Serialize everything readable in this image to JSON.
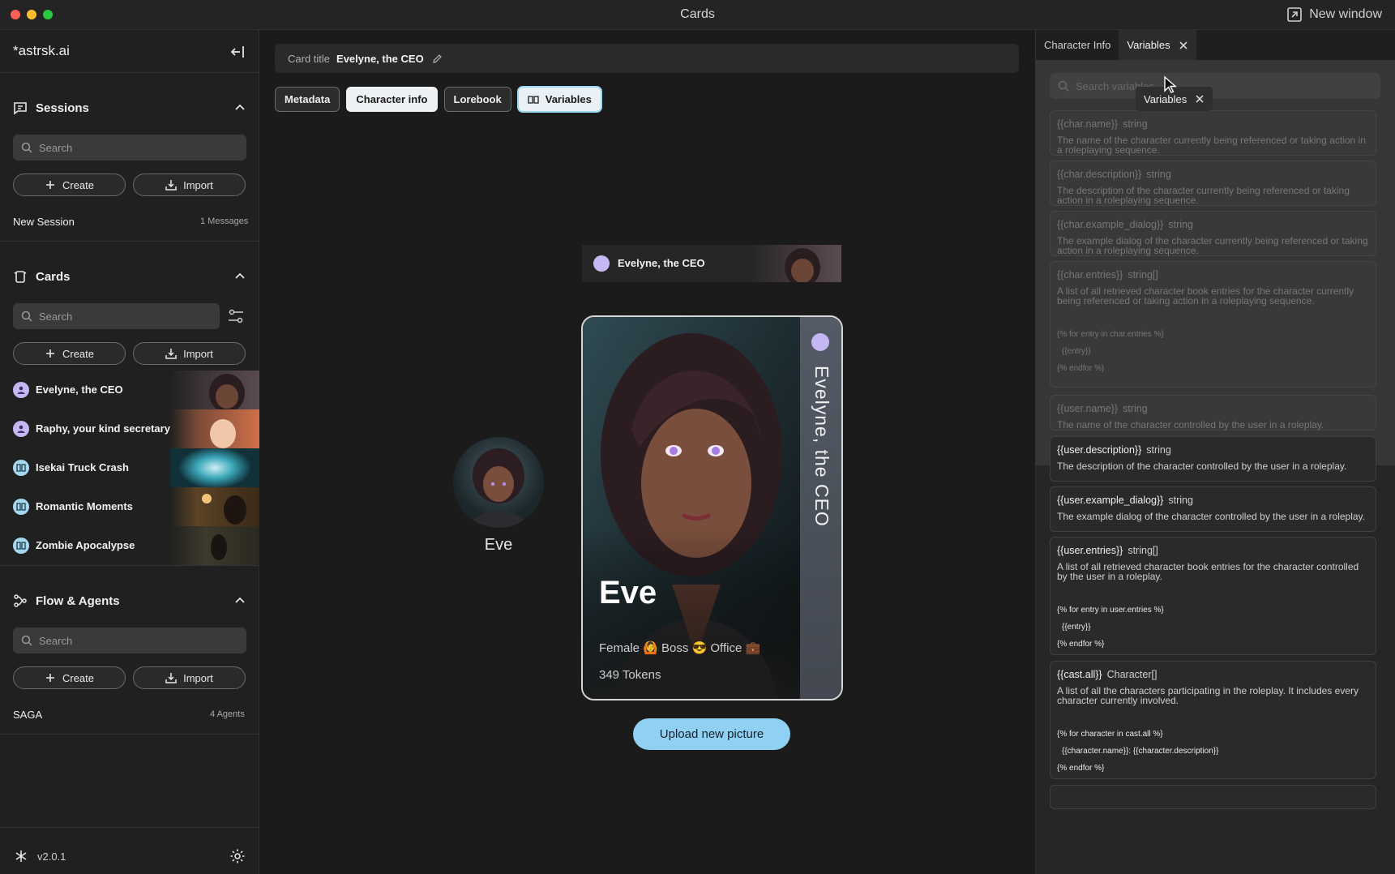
{
  "window": {
    "title": "Cards",
    "new_window": "New window"
  },
  "sidebar": {
    "brand": "*astrsk.ai",
    "sessions": {
      "title": "Sessions",
      "search_placeholder": "Search",
      "create": "Create",
      "import": "Import",
      "items": [
        {
          "name": "New Session",
          "meta": "1 Messages"
        }
      ]
    },
    "cards": {
      "title": "Cards",
      "search_placeholder": "Search",
      "create": "Create",
      "import": "Import",
      "items": [
        {
          "name": "Evelyne, the CEO",
          "kind": "character"
        },
        {
          "name": "Raphy, your kind secretary",
          "kind": "character"
        },
        {
          "name": "Isekai Truck Crash",
          "kind": "plot"
        },
        {
          "name": "Romantic Moments",
          "kind": "plot"
        },
        {
          "name": "Zombie Apocalypse",
          "kind": "plot"
        }
      ]
    },
    "flows": {
      "title": "Flow & Agents",
      "search_placeholder": "Search",
      "create": "Create",
      "import": "Import",
      "items": [
        {
          "name": "SAGA",
          "meta": "4 Agents"
        }
      ]
    },
    "version": "v2.0.1"
  },
  "main": {
    "card_title_label": "Card title",
    "card_title_value": "Evelyne, the CEO",
    "tabs": [
      "Metadata",
      "Character info",
      "Lorebook",
      "Variables"
    ],
    "session_row_name": "Evelyne, the CEO",
    "avatar_name": "Eve",
    "card": {
      "name": "Eve",
      "vertical_title": "Evelyne, the CEO",
      "tags": "Female 🙆 Boss 😎 Office 💼",
      "tokens": "349 Tokens"
    },
    "upload_button": "Upload new picture"
  },
  "right_panel": {
    "tabs": [
      "Character Info",
      "Variables"
    ],
    "search_placeholder": "Search variables",
    "tooltip": "Variables",
    "variables": [
      {
        "name": "{{char.name}}",
        "type": "string",
        "desc": "The name of the character currently being referenced or taking action in a roleplaying sequence.",
        "code": []
      },
      {
        "name": "{{char.description}}",
        "type": "string",
        "desc": "The description of the character currently being referenced or taking action in a roleplaying sequence.",
        "code": []
      },
      {
        "name": "{{char.example_dialog}}",
        "type": "string",
        "desc": "The example dialog of the character currently being referenced or taking action in a roleplaying sequence.",
        "code": []
      },
      {
        "name": "{{char.entries}}",
        "type": "string[]",
        "desc": "A list of all retrieved character book entries for the character currently being referenced or taking action in a roleplaying sequence.",
        "code": [
          "{% for entry in char.entries %}",
          "{{entry}}",
          "{% endfor %}"
        ]
      },
      {
        "name": "{{user.name}}",
        "type": "string",
        "desc": "The name of the character controlled by the user in a roleplay.",
        "code": []
      },
      {
        "name": "{{user.description}}",
        "type": "string",
        "desc": "The description of the character controlled by the user in a roleplay.",
        "code": []
      },
      {
        "name": "{{user.example_dialog}}",
        "type": "string",
        "desc": "The example dialog of the character controlled by the user in a roleplay.",
        "code": []
      },
      {
        "name": "{{user.entries}}",
        "type": "string[]",
        "desc": "A list of all retrieved character book entries for the character controlled by the user in a roleplay.",
        "code": [
          "{% for entry in user.entries %}",
          "{{entry}}",
          "{% endfor %}"
        ]
      },
      {
        "name": "{{cast.all}}",
        "type": "Character[]",
        "desc": "A list of all the characters participating in the roleplay. It includes every character currently involved.",
        "code": [
          "{% for character in cast.all %}",
          "{{character.name}}: {{character.description}}",
          "{% endfor %}"
        ]
      }
    ]
  },
  "colors": {
    "accent": "#8fd0f3",
    "character_icon": "#c5b7f3",
    "plot_icon": "#a8d8f0"
  }
}
